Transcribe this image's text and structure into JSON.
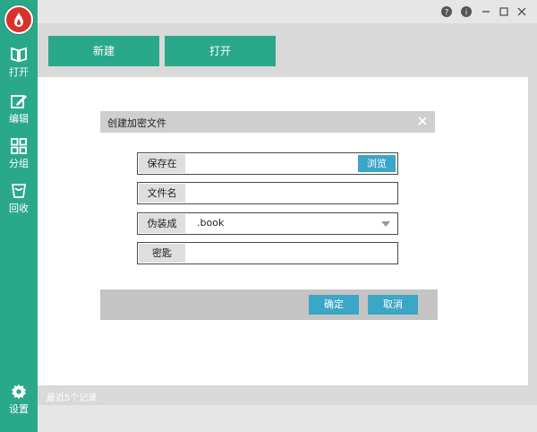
{
  "sidebar": {
    "items": [
      {
        "label": "打开",
        "icon": "book-icon"
      },
      {
        "label": "编辑",
        "icon": "edit-icon"
      },
      {
        "label": "分组",
        "icon": "grid-icon"
      },
      {
        "label": "回收",
        "icon": "trash-bag-icon"
      }
    ],
    "settings_label": "设置"
  },
  "toolbar": {
    "new_label": "新建",
    "open_label": "打开"
  },
  "dialog": {
    "title": "创建加密文件",
    "save_in": {
      "label": "保存在",
      "value": "",
      "browse_label": "浏览"
    },
    "file_name": {
      "label": "文件名",
      "value": ""
    },
    "disguise": {
      "label": "伪装成",
      "value": ".book"
    },
    "password": {
      "label": "密匙",
      "value": ""
    },
    "ok_label": "确定",
    "cancel_label": "取消"
  },
  "status": {
    "recent_label": "最近5个记录"
  },
  "colors": {
    "accent": "#2aa88a",
    "button_blue": "#3ba6c6",
    "logo_red": "#d8322c"
  }
}
